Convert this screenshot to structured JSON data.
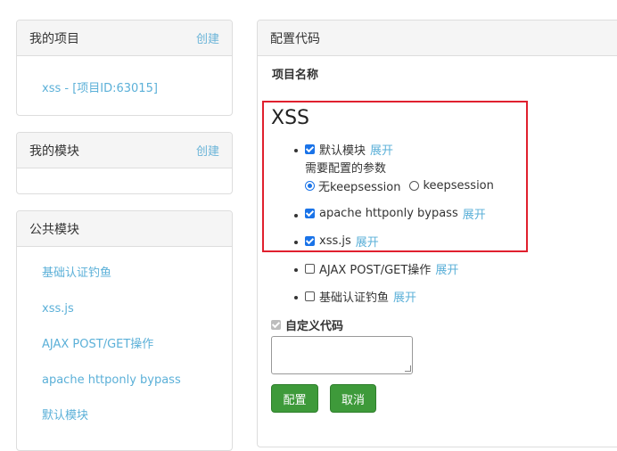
{
  "my_projects": {
    "title": "我的项目",
    "create_label": "创建",
    "items": [
      {
        "label": "xss - [项目ID:63015]"
      }
    ]
  },
  "my_modules": {
    "title": "我的模块",
    "create_label": "创建"
  },
  "public_modules": {
    "title": "公共模块",
    "items": [
      {
        "label": "基础认证钓鱼"
      },
      {
        "label": "xss.js"
      },
      {
        "label": "AJAX POST/GET操作"
      },
      {
        "label": "apache httponly bypass"
      },
      {
        "label": "默认模块"
      }
    ]
  },
  "config": {
    "title": "配置代码",
    "project_name_label": "项目名称",
    "project_name": "XSS",
    "modules": [
      {
        "label": "默认模块",
        "checked": true,
        "expand": "展开"
      },
      {
        "label": "apache httponly bypass",
        "checked": true,
        "expand": "展开"
      },
      {
        "label": "xss.js",
        "checked": true,
        "expand": "展开"
      },
      {
        "label": "AJAX POST/GET操作",
        "checked": false,
        "expand": "展开"
      },
      {
        "label": "基础认证钓鱼",
        "checked": false,
        "expand": "展开"
      }
    ],
    "params_label": "需要配置的参数",
    "radio_options": [
      {
        "label": "无keepsession",
        "checked": true
      },
      {
        "label": "keepsession",
        "checked": false
      }
    ],
    "custom_code_label": "自定义代码",
    "custom_code_value": "",
    "submit_label": "配置",
    "cancel_label": "取消"
  },
  "colors": {
    "link": "#5bb0d8",
    "highlight_border": "#e0202e",
    "button": "#3e9a3a",
    "checkbox": "#1a73e8"
  }
}
